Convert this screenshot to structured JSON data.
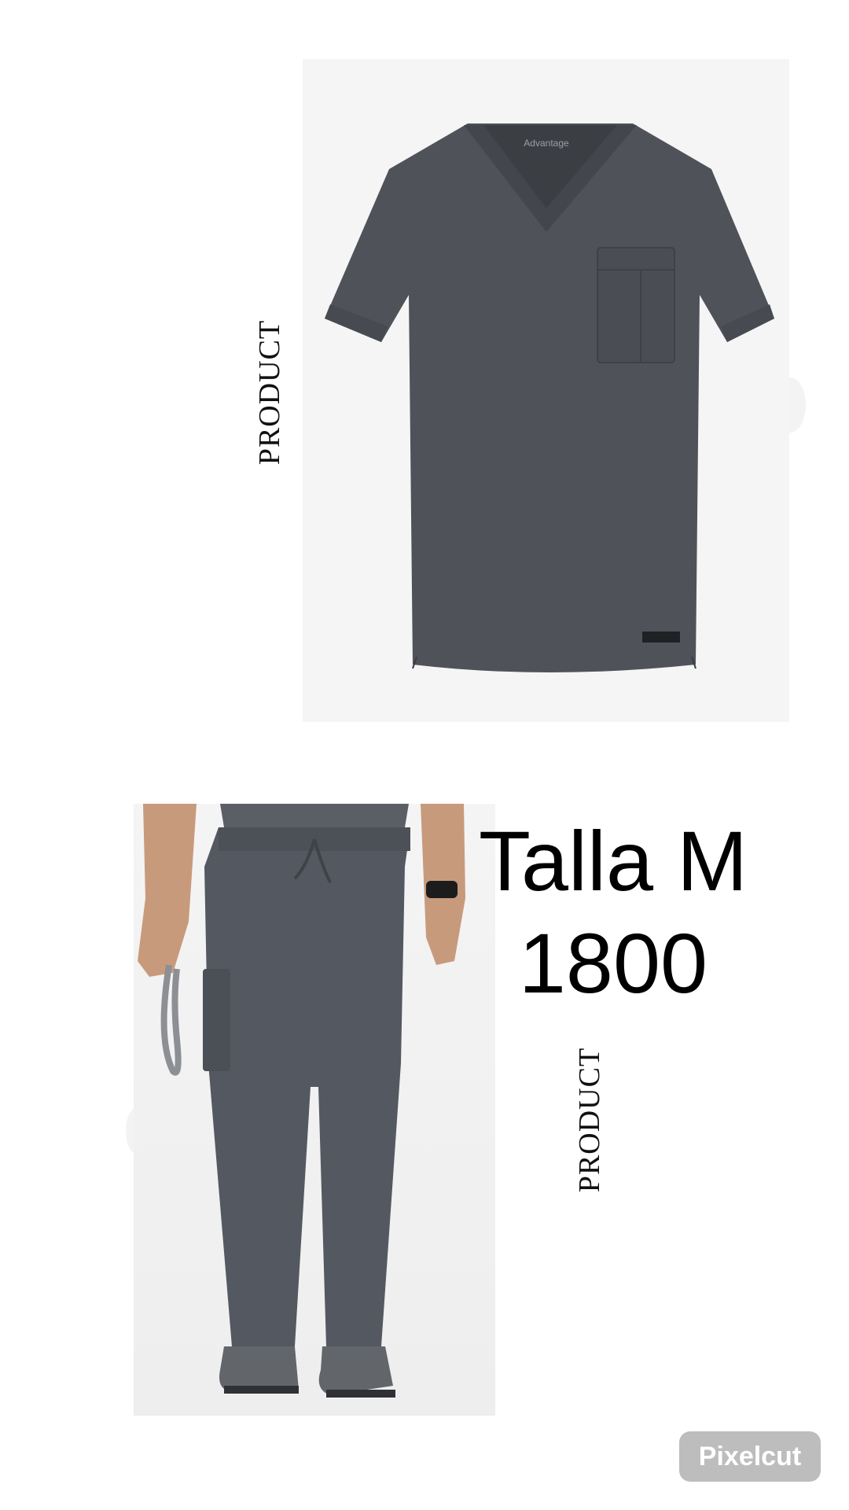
{
  "products": [
    {
      "label": "PRODUCT",
      "image": "scrub-top-icon",
      "brand_tag": "Advantage"
    },
    {
      "label": "PRODUCT",
      "image": "scrub-pants-icon"
    }
  ],
  "info": {
    "size": "Talla M",
    "price": "1800"
  },
  "watermark": "Pixelcut",
  "colors": {
    "garment": "#4f5359",
    "photo_bg": "#f5f5f5"
  }
}
